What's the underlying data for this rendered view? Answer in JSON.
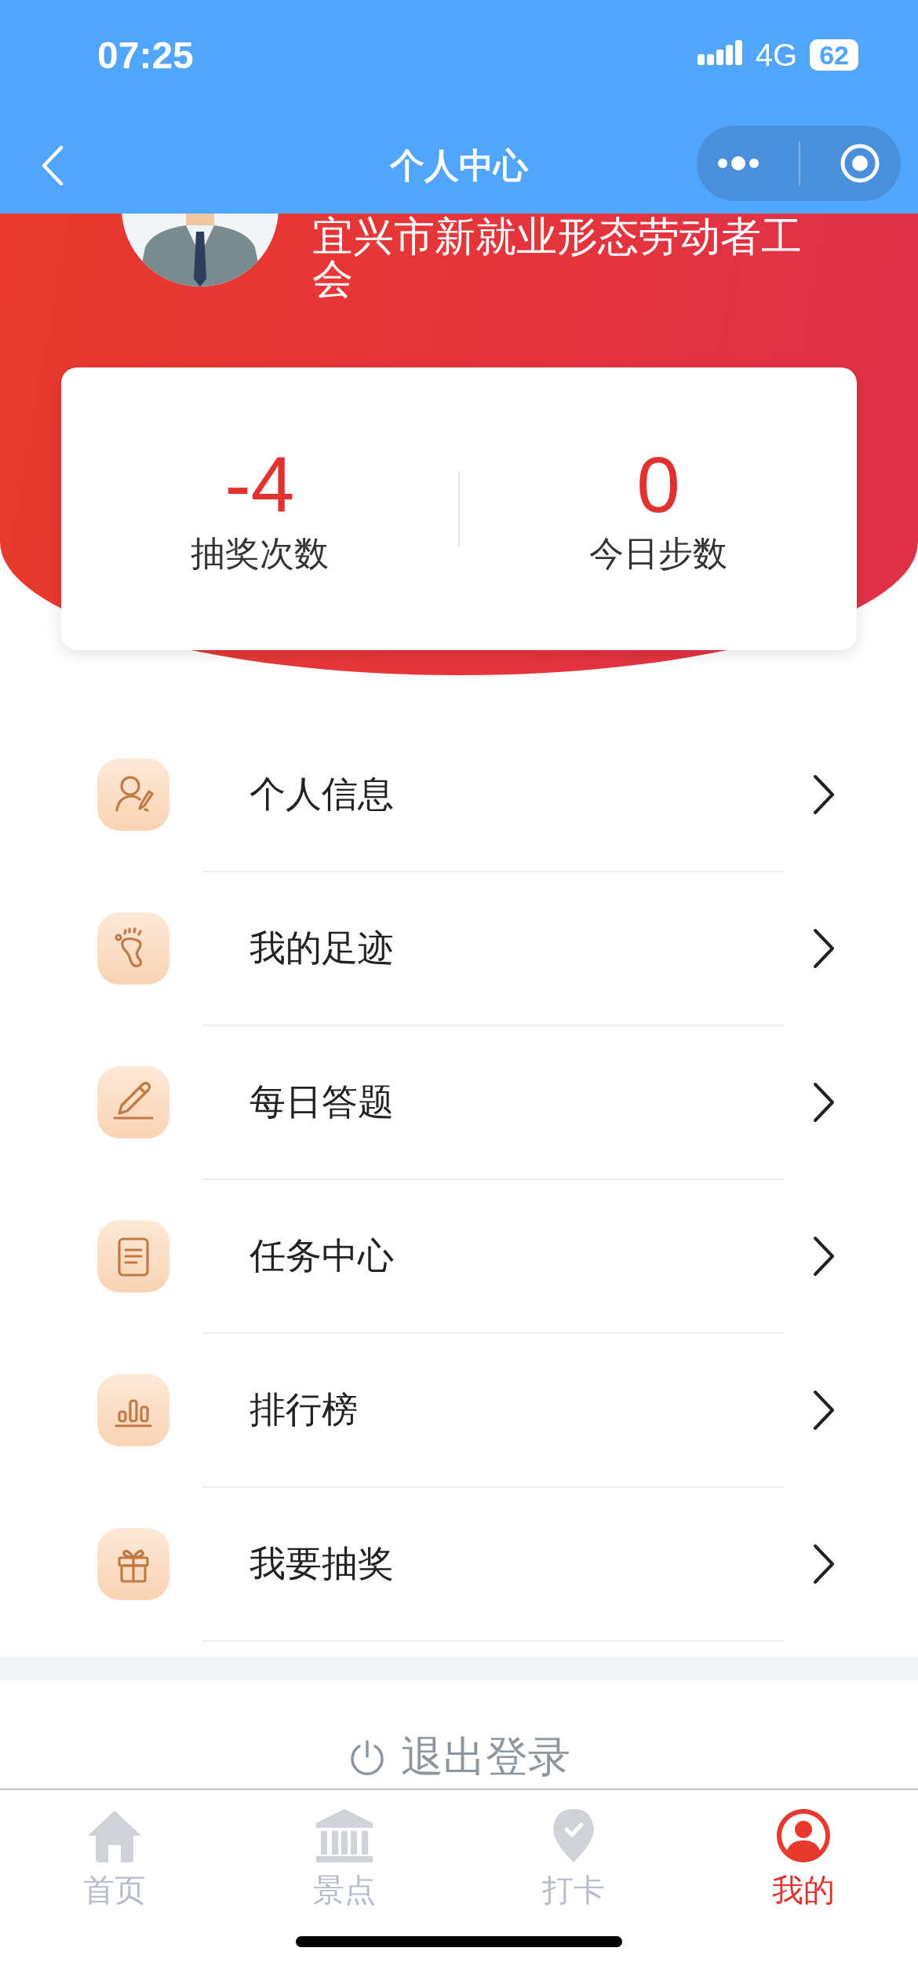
{
  "status_bar": {
    "time": "07:25",
    "network": "4G",
    "battery": "62"
  },
  "nav": {
    "title": "个人中心"
  },
  "profile": {
    "org_name": "宜兴市新就业形态劳动者工会"
  },
  "stats": [
    {
      "value": "-4",
      "label": "抽奖次数"
    },
    {
      "value": "0",
      "label": "今日步数"
    }
  ],
  "menu": [
    {
      "label": "个人信息",
      "kind": "person"
    },
    {
      "label": "我的足迹",
      "kind": "footprint"
    },
    {
      "label": "每日答题",
      "kind": "pencil"
    },
    {
      "label": "任务中心",
      "kind": "document"
    },
    {
      "label": "排行榜",
      "kind": "chart"
    },
    {
      "label": "我要抽奖",
      "kind": "gift"
    }
  ],
  "logout": {
    "label": "退出登录"
  },
  "tabs": [
    {
      "label": "首页",
      "kind": "home",
      "selected": false
    },
    {
      "label": "景点",
      "kind": "museum",
      "selected": false
    },
    {
      "label": "打卡",
      "kind": "pin",
      "selected": false
    },
    {
      "label": "我的",
      "kind": "user",
      "selected": true
    }
  ]
}
